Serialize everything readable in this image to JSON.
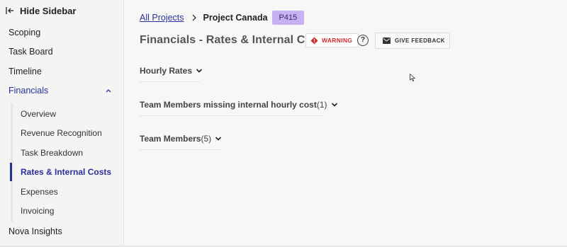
{
  "sidebar": {
    "hide_label": "Hide Sidebar",
    "items": [
      {
        "label": "Scoping"
      },
      {
        "label": "Task Board"
      },
      {
        "label": "Timeline"
      },
      {
        "label": "Financials"
      }
    ],
    "financials_sub": [
      {
        "label": "Overview"
      },
      {
        "label": "Revenue Recognition"
      },
      {
        "label": "Task Breakdown"
      },
      {
        "label": "Rates & Internal Costs"
      },
      {
        "label": "Expenses"
      },
      {
        "label": "Invoicing"
      }
    ],
    "bottom_item": "Nova Insights",
    "active_color": "#2a2f9e"
  },
  "breadcrumb": {
    "parent": "All Projects",
    "current": "Project Canada",
    "code": "P415"
  },
  "header": {
    "title": "Financials - Rates & Internal Costs",
    "warning_label": "WARNING",
    "help_glyph": "?",
    "feedback_label": "GIVE FEEDBACK",
    "warning_color": "#d12a2a",
    "badge_color": "#c8b1f1"
  },
  "sections": [
    {
      "label": "Hourly Rates",
      "count": ""
    },
    {
      "label": "Team Members missing internal hourly cost",
      "count": "(1)"
    },
    {
      "label": "Team Members",
      "count": "(5)"
    }
  ]
}
